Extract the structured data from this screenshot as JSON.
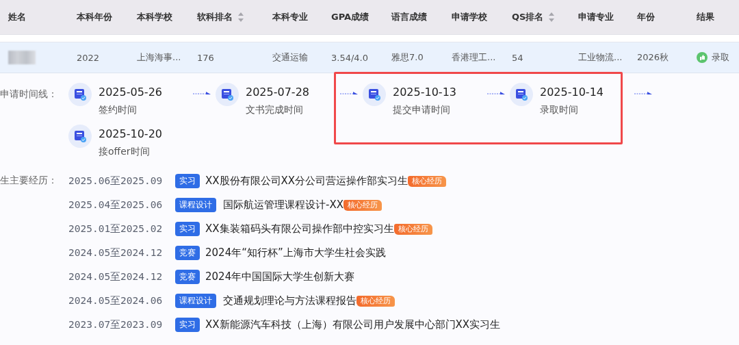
{
  "table": {
    "columns": [
      {
        "label": "姓名",
        "sortable": false
      },
      {
        "label": "本科年份",
        "sortable": false
      },
      {
        "label": "本科学校",
        "sortable": false
      },
      {
        "label": "软科排名",
        "sortable": true
      },
      {
        "label": "本科专业",
        "sortable": false
      },
      {
        "label": "GPA成绩",
        "sortable": false
      },
      {
        "label": "语言成绩",
        "sortable": false
      },
      {
        "label": "申请学校",
        "sortable": false
      },
      {
        "label": "QS排名",
        "sortable": true
      },
      {
        "label": "申请专业",
        "sortable": false
      },
      {
        "label": "年份",
        "sortable": false
      },
      {
        "label": "结果",
        "sortable": false
      }
    ],
    "rows": [
      {
        "name_redacted": true,
        "cells": [
          "",
          "2022",
          "上海海事...",
          "176",
          "交通运输",
          "3.54/4.0",
          "雅思7.0",
          "香港理工...",
          "54",
          "工业物流...",
          "2026秋"
        ],
        "result": {
          "label": "录取",
          "kind": "admitted"
        }
      }
    ]
  },
  "timeline": {
    "label": "申请时间线：",
    "steps": [
      {
        "date": "2025-05-26",
        "caption": "签约时间",
        "highlighted": false
      },
      {
        "date": "2025-07-28",
        "caption": "文书完成时间",
        "highlighted": false
      },
      {
        "date": "2025-10-13",
        "caption": "提交申请时间",
        "highlighted": true
      },
      {
        "date": "2025-10-14",
        "caption": "录取时间",
        "highlighted": true
      },
      {
        "date": "2025-10-20",
        "caption": "接offer时间",
        "highlighted": false
      }
    ]
  },
  "experience": {
    "label": "生主要经历：",
    "items": [
      {
        "period": "2025.06至2025.09",
        "tag": "实习",
        "title": "XX股份有限公司XX分公司营运操作部实习生",
        "core": "核心经历"
      },
      {
        "period": "2025.04至2025.06",
        "tag": "课程设计",
        "title": "国际航运管理课程设计-XX",
        "core": "核心经历"
      },
      {
        "period": "2025.01至2025.02",
        "tag": "实习",
        "title": "XX集装箱码头有限公司操作部中控实习生",
        "core": "核心经历"
      },
      {
        "period": "2024.05至2024.12",
        "tag": "竞赛",
        "title": "2024年“知行杯”上海市大学生社会实践"
      },
      {
        "period": "2024.05至2024.12",
        "tag": "竞赛",
        "title": "2024年中国国际大学生创新大赛"
      },
      {
        "period": "2024.05至2024.06",
        "tag": "课程设计",
        "title": "交通规划理论与方法课程报告",
        "core": "核心经历"
      },
      {
        "period": "2023.07至2023.09",
        "tag": "实习",
        "title": "XX新能源汽车科技（上海）有限公司用户发展中心部门XX实习生"
      }
    ]
  }
}
